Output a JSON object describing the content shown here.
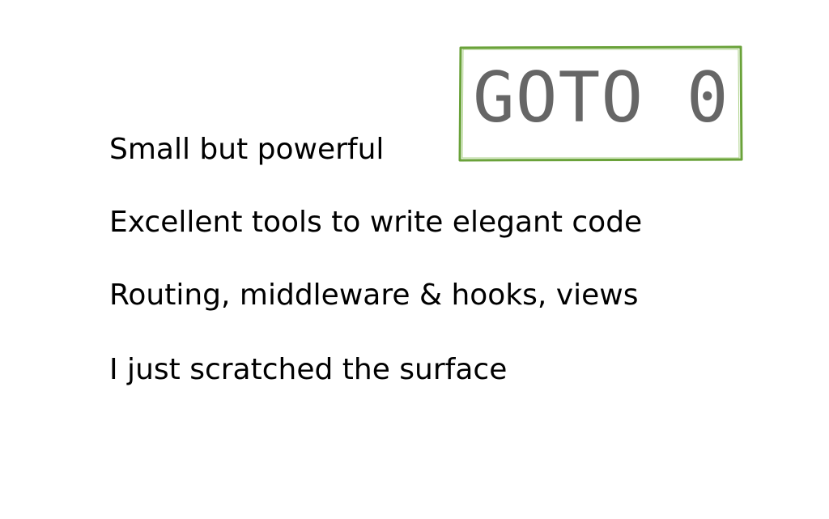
{
  "stamp": {
    "text": "GOTO 0",
    "border_color": "#6aa23a",
    "text_color": "#666666"
  },
  "bullets": [
    {
      "text": "Small but powerful"
    },
    {
      "text": "Excellent tools to write elegant code"
    },
    {
      "text": "Routing, middleware & hooks, views"
    },
    {
      "text": "I just scratched the surface"
    }
  ]
}
